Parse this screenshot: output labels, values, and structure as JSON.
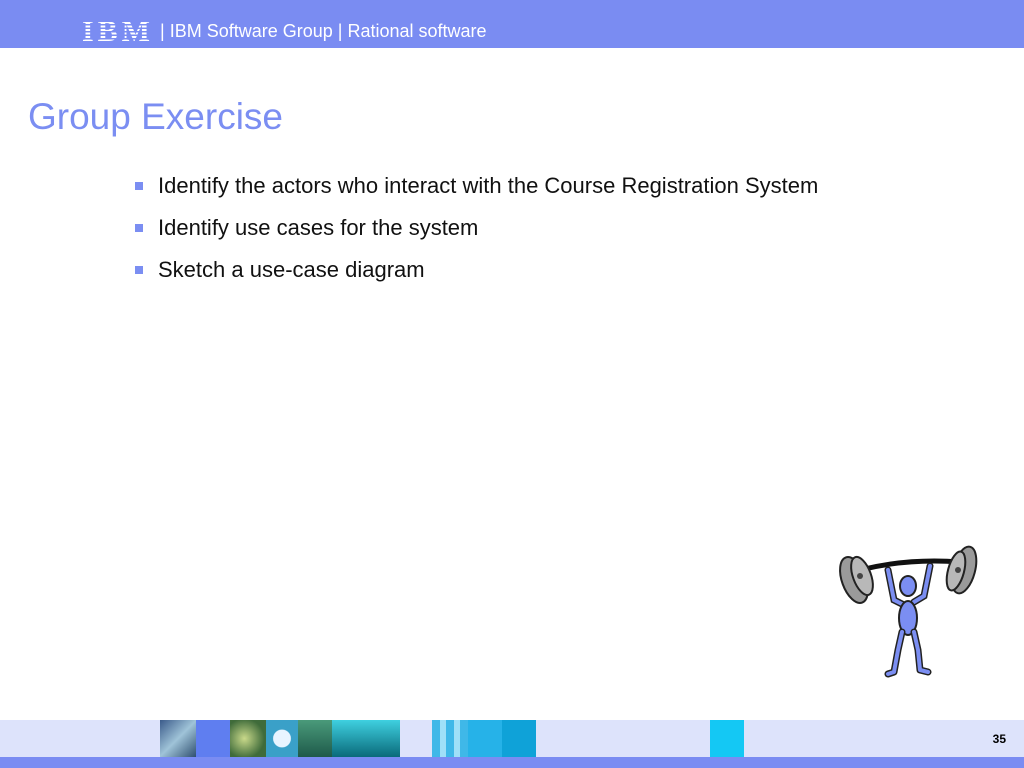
{
  "header": {
    "logo": "IBM",
    "separator": "|",
    "group_text": "IBM Software Group | Rational software"
  },
  "slide": {
    "title": "Group Exercise",
    "bullets": [
      "Identify the actors who interact with the Course Registration System",
      "Identify use cases for the system",
      "Sketch a use-case diagram"
    ]
  },
  "footer": {
    "page_number": "35"
  },
  "colors": {
    "brand_blue": "#7a8cf2",
    "title_blue": "#7b8ef2"
  },
  "icons": {
    "bullet": "square-bullet-icon",
    "clipart": "weightlifter-icon"
  }
}
